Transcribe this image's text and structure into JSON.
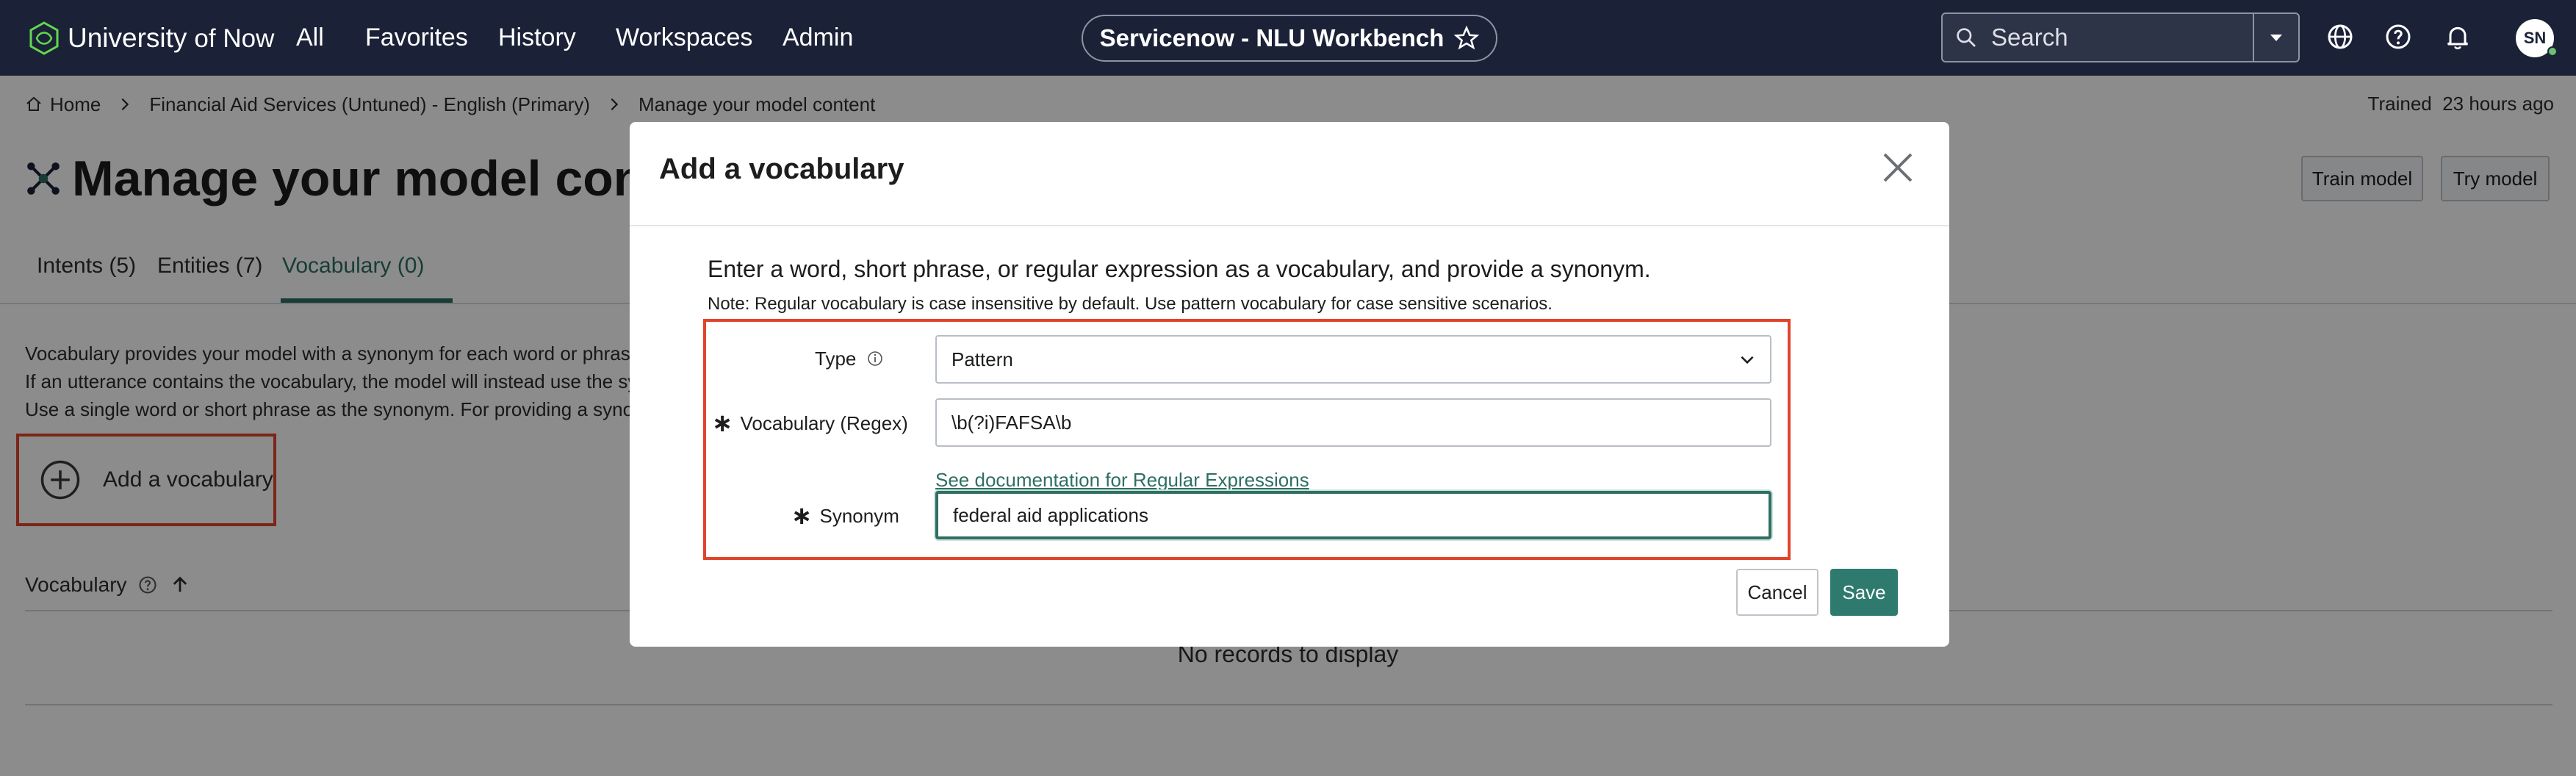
{
  "topnav": {
    "brand_part1": "University",
    "brand_part2": "of Now",
    "items": [
      "All",
      "Favorites",
      "History",
      "Workspaces",
      "Admin"
    ],
    "app_title": "Servicenow - NLU Workbench",
    "search_placeholder": "Search",
    "avatar_initials": "SN",
    "icons": [
      "globe-icon",
      "help-icon",
      "bell-icon"
    ]
  },
  "breadcrumb": {
    "items": [
      "Home",
      "Financial Aid Services (Untuned) - English (Primary)",
      "Manage your model content"
    ]
  },
  "trained": {
    "label": "Trained",
    "value": "23 hours ago"
  },
  "page": {
    "title": "Manage your model conten",
    "train_button": "Train model",
    "try_button": "Try model",
    "tabs": [
      "Intents (5)",
      "Entities (7)",
      "Vocabulary (0)"
    ],
    "active_tab": "Vocabulary (0)",
    "description": [
      "Vocabulary provides your model with a synonym for each word or phrase tha",
      "If an utterance contains the vocabulary, the model will instead use the synon",
      "Use a single word or short phrase as the synonym. For providing a synonym f"
    ],
    "add_vocabulary": "Add a vocabulary",
    "column_header": "Vocabulary",
    "empty_text": "No records to display"
  },
  "modal": {
    "title": "Add a vocabulary",
    "intro": "Enter a word, short phrase, or regular expression as a vocabulary, and provide a synonym.",
    "note": "Note: Regular vocabulary is case insensitive by default. Use pattern vocabulary for case sensitive scenarios.",
    "type_label": "Type",
    "type_value": "Pattern",
    "vocab_label": "Vocabulary (Regex)",
    "vocab_value": "\\b(?i)FAFSA\\b",
    "doc_link": "See documentation for Regular Expressions",
    "synonym_label": "Synonym",
    "synonym_value": "federal aid applications",
    "cancel": "Cancel",
    "save": "Save"
  },
  "colors": {
    "nav_bg": "#1b2237",
    "accent": "#2f6f63",
    "highlight": "#e0452c"
  }
}
